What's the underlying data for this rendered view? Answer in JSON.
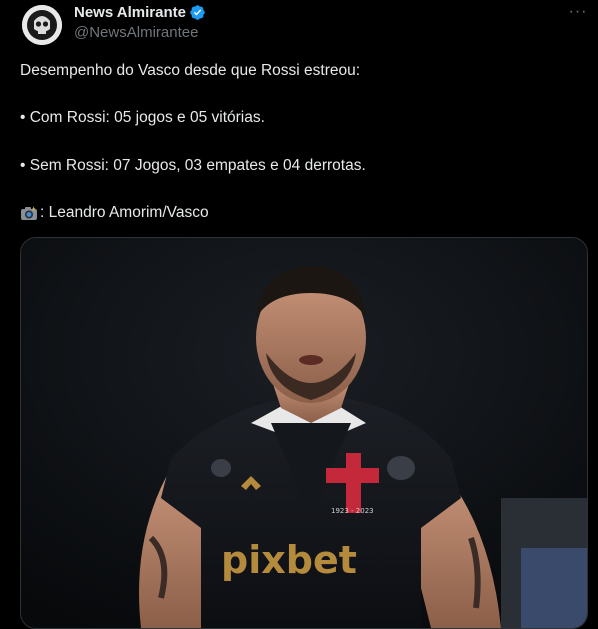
{
  "author": {
    "display_name": "News Almirante",
    "handle": "@NewsAlmirantee",
    "avatar_icon": "skull-avatar",
    "verified_icon": "verified-badge-icon",
    "verified_color": "#1d9bf0"
  },
  "actions": {
    "more_icon": "more-options-icon",
    "more_label": "···"
  },
  "tweet": {
    "line1": "Desempenho do Vasco desde que Rossi estreou:",
    "line2": "• Com Rossi: 05 jogos e 05 vitórias.",
    "line3": "• Sem Rossi: 07 Jogos, 03 empates e 04 derrotas.",
    "line4": ": Leandro Amorim/Vasco",
    "line4_icon": "camera-flash-emoji"
  },
  "media": {
    "jersey_sponsor": "pixbet",
    "crest_text": "1923 - 2023"
  },
  "colors": {
    "background": "#000000",
    "text_primary": "#e7e9ea",
    "text_secondary": "#71767b",
    "border": "#2f3336"
  }
}
